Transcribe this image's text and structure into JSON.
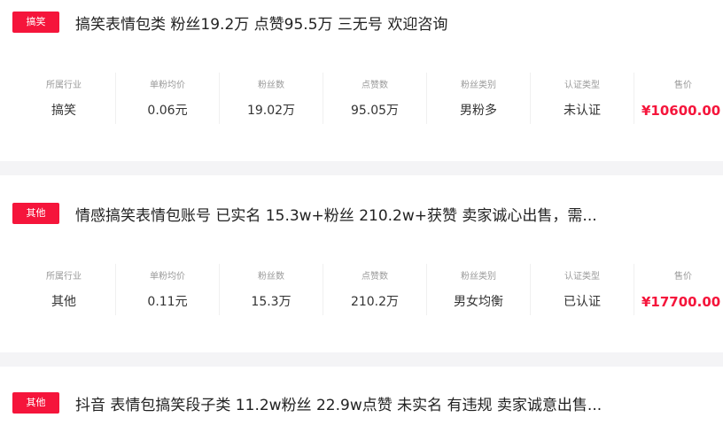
{
  "stat_labels": {
    "industry": "所属行业",
    "unit_price": "单粉均价",
    "fans": "粉丝数",
    "likes": "点赞数",
    "fan_type": "粉丝类别",
    "cert": "认证类型",
    "price": "售价"
  },
  "listings": [
    {
      "tag": "搞笑",
      "title": "搞笑表情包类 粉丝19.2万 点赞95.5万 三无号 欢迎咨询",
      "industry": "搞笑",
      "unit_price": "0.06元",
      "fans": "19.02万",
      "likes": "95.05万",
      "fan_type": "男粉多",
      "cert": "未认证",
      "price": "¥10600.00"
    },
    {
      "tag": "其他",
      "title": "情感搞笑表情包账号 已实名 15.3w+粉丝 210.2w+获赞 卖家诚心出售，需...",
      "industry": "其他",
      "unit_price": "0.11元",
      "fans": "15.3万",
      "likes": "210.2万",
      "fan_type": "男女均衡",
      "cert": "已认证",
      "price": "¥17700.00"
    },
    {
      "tag": "其他",
      "title": "抖音 表情包搞笑段子类 11.2w粉丝 22.9w点赞 未实名 有违规 卖家诚意出售..."
    }
  ],
  "colors": {
    "accent": "#f5153b",
    "divider": "#f4f4f6",
    "label": "#9a9a9a",
    "text": "#333333"
  }
}
